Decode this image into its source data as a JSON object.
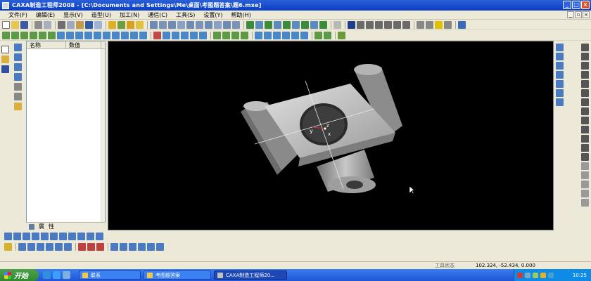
{
  "window": {
    "title": "CAXA制造工程师2008  - [C:\\Documents and Settings\\Me\\桌面\\考图题答案\\题6.mxe]",
    "controls": [
      "minimize",
      "maximize",
      "close"
    ]
  },
  "menu": {
    "items": [
      "文件(F)",
      "编辑(E)",
      "显示(V)",
      "造型(U)",
      "加工(N)",
      "通信(C)",
      "工具(S)",
      "设置(Y)",
      "帮助(H)"
    ]
  },
  "tree_panel": {
    "columns": [
      "名称",
      "数值"
    ],
    "tabs": [
      "属",
      "性"
    ]
  },
  "viewport": {
    "background": "#000000",
    "axis_labels": [
      "y",
      "z",
      "x"
    ]
  },
  "status": {
    "state_label": "工具状态",
    "coordinates": "102.324, -52.434, 0.000"
  },
  "taskbar": {
    "start_label": "开始",
    "tasks": [
      "联系",
      "考图题答案",
      "CAXA制造工程师20..."
    ],
    "clock": "10:25"
  },
  "colors": {
    "title_bar": "#0a3ec4",
    "window_bg": "#ece9d8",
    "taskbar": "#245edb",
    "start_button": "#3a9a3a"
  },
  "icons": {
    "toolbar": [
      "new-icon",
      "open-icon",
      "save-icon",
      "print-icon",
      "cut-icon",
      "copy-icon",
      "paste-icon",
      "undo-icon",
      "redo-icon",
      "zoom-in-icon",
      "zoom-out-icon",
      "pan-icon",
      "rotate-icon"
    ],
    "right_tools": [
      "line-icon",
      "arc-icon",
      "circle-icon",
      "rectangle-icon",
      "spline-icon",
      "text-icon"
    ]
  }
}
